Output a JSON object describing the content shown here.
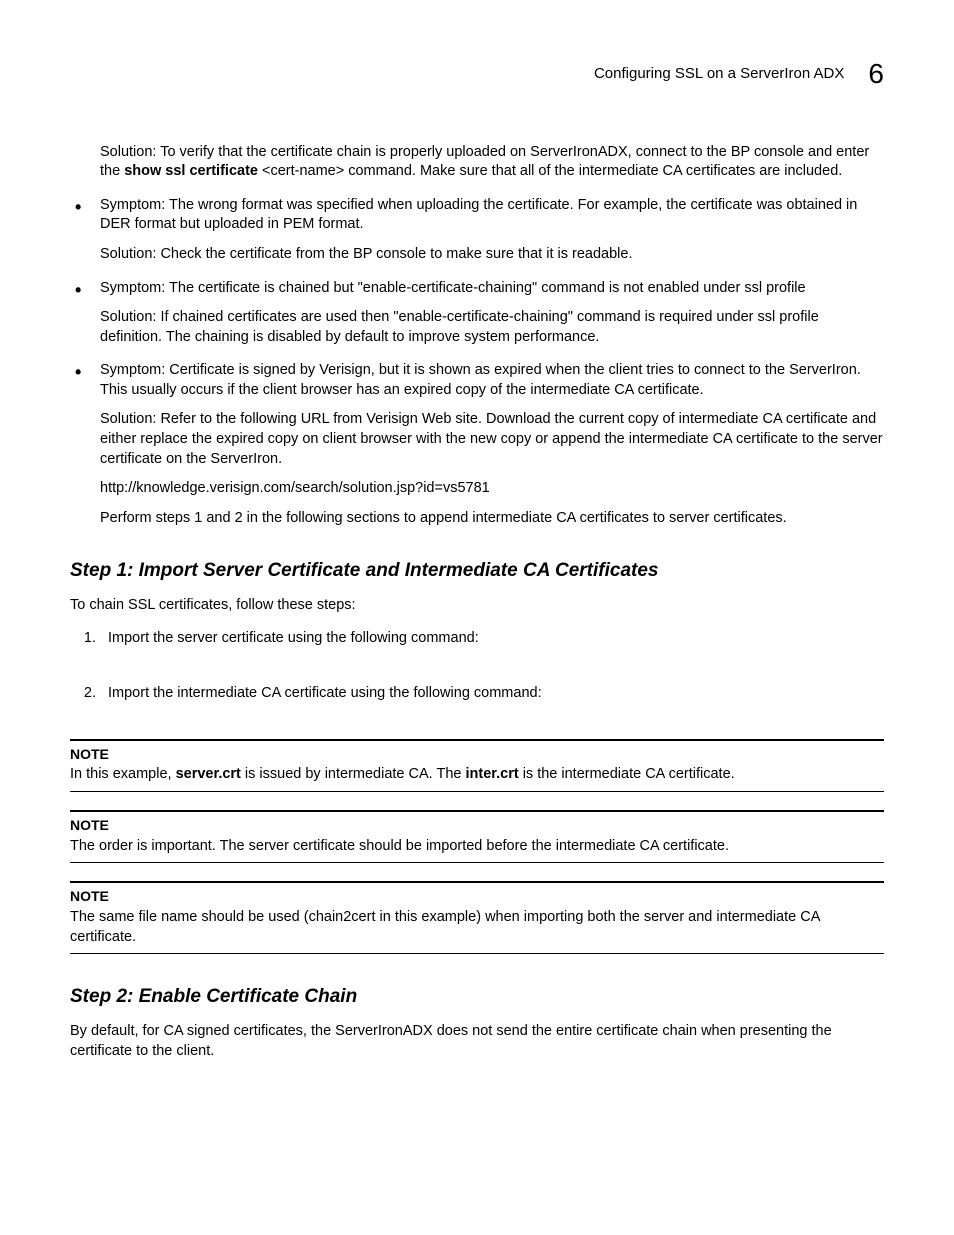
{
  "header": {
    "title": "Configuring SSL on a ServerIron ADX",
    "chapter_number": "6"
  },
  "intro": {
    "solution_prefix": "Solution: To verify that the certificate chain is properly uploaded on ServerIronADX, connect to the BP console and enter the ",
    "solution_bold": "show ssl certificate",
    "solution_suffix": " <cert-name> command. Make sure that all of the intermediate CA certificates are included."
  },
  "bullets": [
    {
      "symptom": "Symptom: The wrong format was specified when uploading the certificate. For example, the certificate was obtained in DER format but uploaded in PEM format.",
      "solution": "Solution: Check the certificate from the BP console to make sure that it is readable."
    },
    {
      "symptom": "Symptom: The certificate is chained but \"enable-certificate-chaining\" command is not enabled under ssl profile",
      "solution": "Solution: If chained certificates are used then \"enable-certificate-chaining\" command is required under ssl profile definition. The chaining is disabled by default to improve system performance."
    },
    {
      "symptom": "Symptom: Certificate is signed by Verisign, but it is shown as expired when the client tries to connect to the ServerIron. This usually occurs if the client browser has an expired copy of the intermediate CA certificate.",
      "solution": "Solution: Refer to the following URL from Verisign Web site. Download the current copy of intermediate CA certificate and either replace the expired copy on client browser with the new copy or append the intermediate CA certificate to the server certificate on the ServerIron.",
      "url": "http://knowledge.verisign.com/search/solution.jsp?id=vs5781",
      "followup": "Perform steps 1 and 2 in the following sections to append intermediate CA certificates to server certificates."
    }
  ],
  "step1": {
    "heading": "Step 1: Import Server Certificate and Intermediate CA Certificates",
    "intro": "To chain SSL certificates, follow these steps:",
    "items": [
      "Import the server certificate using the following command:",
      "Import the intermediate CA certificate using the following command:"
    ]
  },
  "notes": [
    {
      "label": "NOTE",
      "prefix": "In this example, ",
      "b1": "server.crt",
      "mid": " is issued by intermediate CA. The ",
      "b2": "inter.crt",
      "suffix": " is the intermediate CA certificate."
    },
    {
      "label": "NOTE",
      "text": "The order is important. The server certificate should be imported before the intermediate CA certificate."
    },
    {
      "label": "NOTE",
      "text": "The same file name should be used (chain2cert in this example) when importing both the server and intermediate CA certificate."
    }
  ],
  "step2": {
    "heading": "Step 2: Enable Certificate Chain",
    "text": "By default, for CA signed certificates, the ServerIronADX does not send the entire certificate chain when presenting the certificate to the client."
  }
}
